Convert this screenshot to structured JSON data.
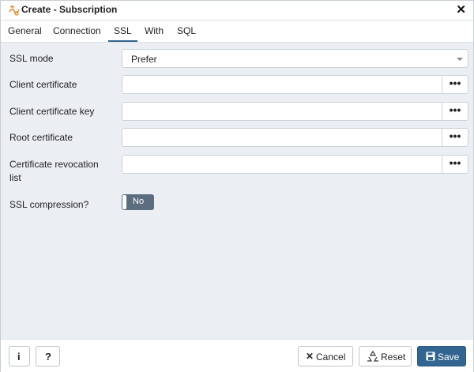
{
  "window": {
    "title": "Create - Subscription",
    "close_icon": "close-icon"
  },
  "tabs": [
    {
      "label": "General",
      "active": false
    },
    {
      "label": "Connection",
      "active": false
    },
    {
      "label": "SSL",
      "active": true
    },
    {
      "label": "With",
      "active": false
    },
    {
      "label": "SQL",
      "active": false
    }
  ],
  "form": {
    "ssl_mode": {
      "label": "SSL mode",
      "value": "Prefer"
    },
    "client_certificate": {
      "label": "Client certificate",
      "value": ""
    },
    "client_certificate_key": {
      "label": "Client certificate key",
      "value": ""
    },
    "root_certificate": {
      "label": "Root certificate",
      "value": ""
    },
    "certificate_revocation_list": {
      "label": "Certificate revocation list",
      "value": ""
    },
    "ssl_compression": {
      "label": "SSL compression?",
      "value": "No"
    },
    "browse_label": "•••"
  },
  "footer": {
    "info_label": "i",
    "help_label": "?",
    "cancel_label": "Cancel",
    "reset_label": "Reset",
    "save_label": "Save"
  },
  "colors": {
    "accent": "#326690",
    "panel_bg": "#ebeef3",
    "toggle_bg": "#5b6d7e"
  }
}
